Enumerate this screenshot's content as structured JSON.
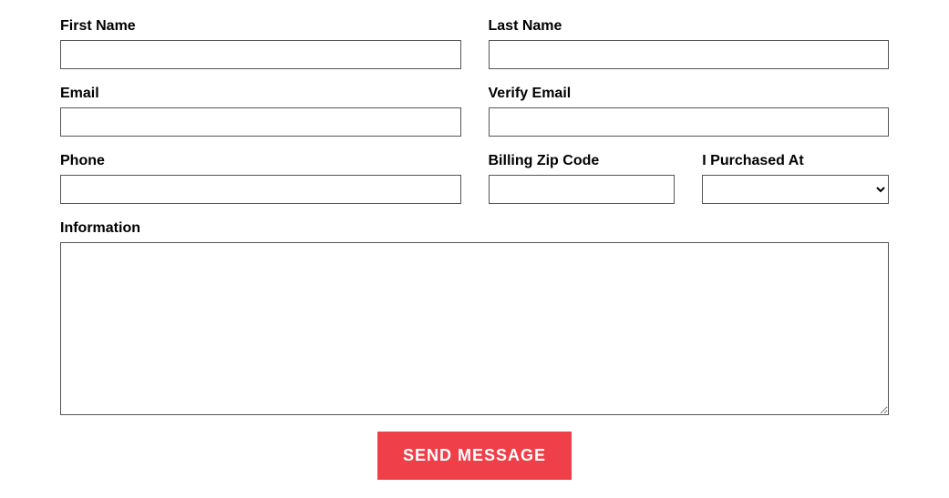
{
  "form": {
    "firstName": {
      "label": "First Name",
      "value": ""
    },
    "lastName": {
      "label": "Last Name",
      "value": ""
    },
    "email": {
      "label": "Email",
      "value": ""
    },
    "verifyEmail": {
      "label": "Verify Email",
      "value": ""
    },
    "phone": {
      "label": "Phone",
      "value": ""
    },
    "billingZip": {
      "label": "Billing Zip Code",
      "value": ""
    },
    "purchasedAt": {
      "label": "I Purchased At",
      "value": ""
    },
    "information": {
      "label": "Information",
      "value": ""
    },
    "submitLabel": "SEND MESSAGE"
  }
}
